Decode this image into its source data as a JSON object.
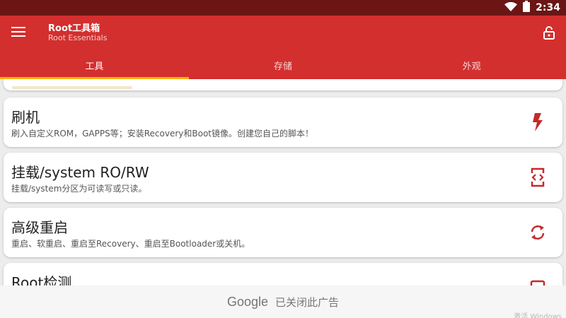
{
  "status": {
    "time": "2:34"
  },
  "toolbar": {
    "title": "Root工具箱",
    "subtitle": "Root Essentials"
  },
  "tabs": [
    {
      "label": "工具",
      "active": true
    },
    {
      "label": "存储",
      "active": false
    },
    {
      "label": "外观",
      "active": false
    }
  ],
  "cards": [
    {
      "title": "刷机",
      "desc": "刷入自定义ROM，GAPPS等；安装Recovery和Boot镜像。创建您自己的脚本！",
      "icon": "flash-icon"
    },
    {
      "title": "挂载/system RO/RW",
      "desc": "挂载/system分区为可读写或只读。",
      "icon": "code-swap-icon"
    },
    {
      "title": "高级重启",
      "desc": "重启、软重启、重启至Recovery、重启至Bootloader或关机。",
      "icon": "refresh-icon"
    },
    {
      "title": "Root检测",
      "desc": "",
      "icon": "check-box-icon"
    }
  ],
  "ad": {
    "brand": "Google",
    "text": "已关闭此广告"
  },
  "watermark": "激活 Windows",
  "colors": {
    "primary": "#d32f2f",
    "status_bar": "#6b1515",
    "accent": "#ffb300"
  }
}
